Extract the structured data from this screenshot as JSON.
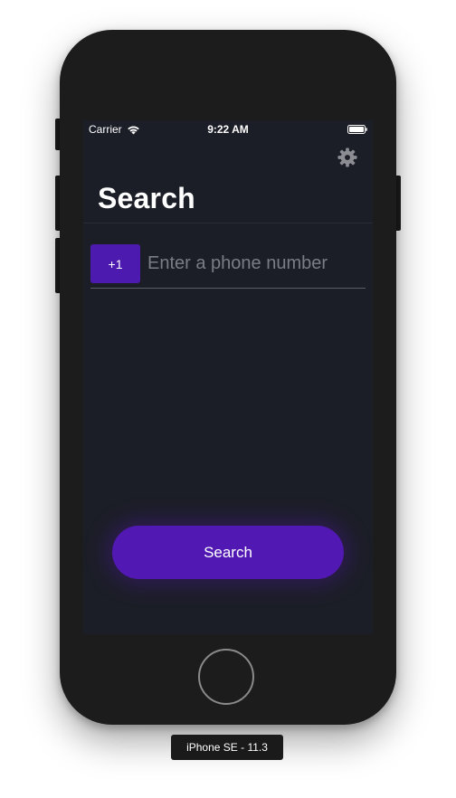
{
  "status_bar": {
    "carrier": "Carrier",
    "wifi_icon": "wifi-icon",
    "time": "9:22 AM",
    "battery_icon": "battery-icon"
  },
  "header": {
    "settings_icon": "gear-icon",
    "title": "Search"
  },
  "phone_form": {
    "country_code": "+1",
    "phone_value": "",
    "phone_placeholder": "Enter a phone number"
  },
  "actions": {
    "search_label": "Search"
  },
  "device": {
    "label": "iPhone SE - 11.3"
  },
  "colors": {
    "screen_background": "#1c1e27",
    "accent": "#5218b3",
    "country_code_background": "#4d1aaf",
    "placeholder": "#7b7d86",
    "phone_body": "#1c1c1c"
  }
}
